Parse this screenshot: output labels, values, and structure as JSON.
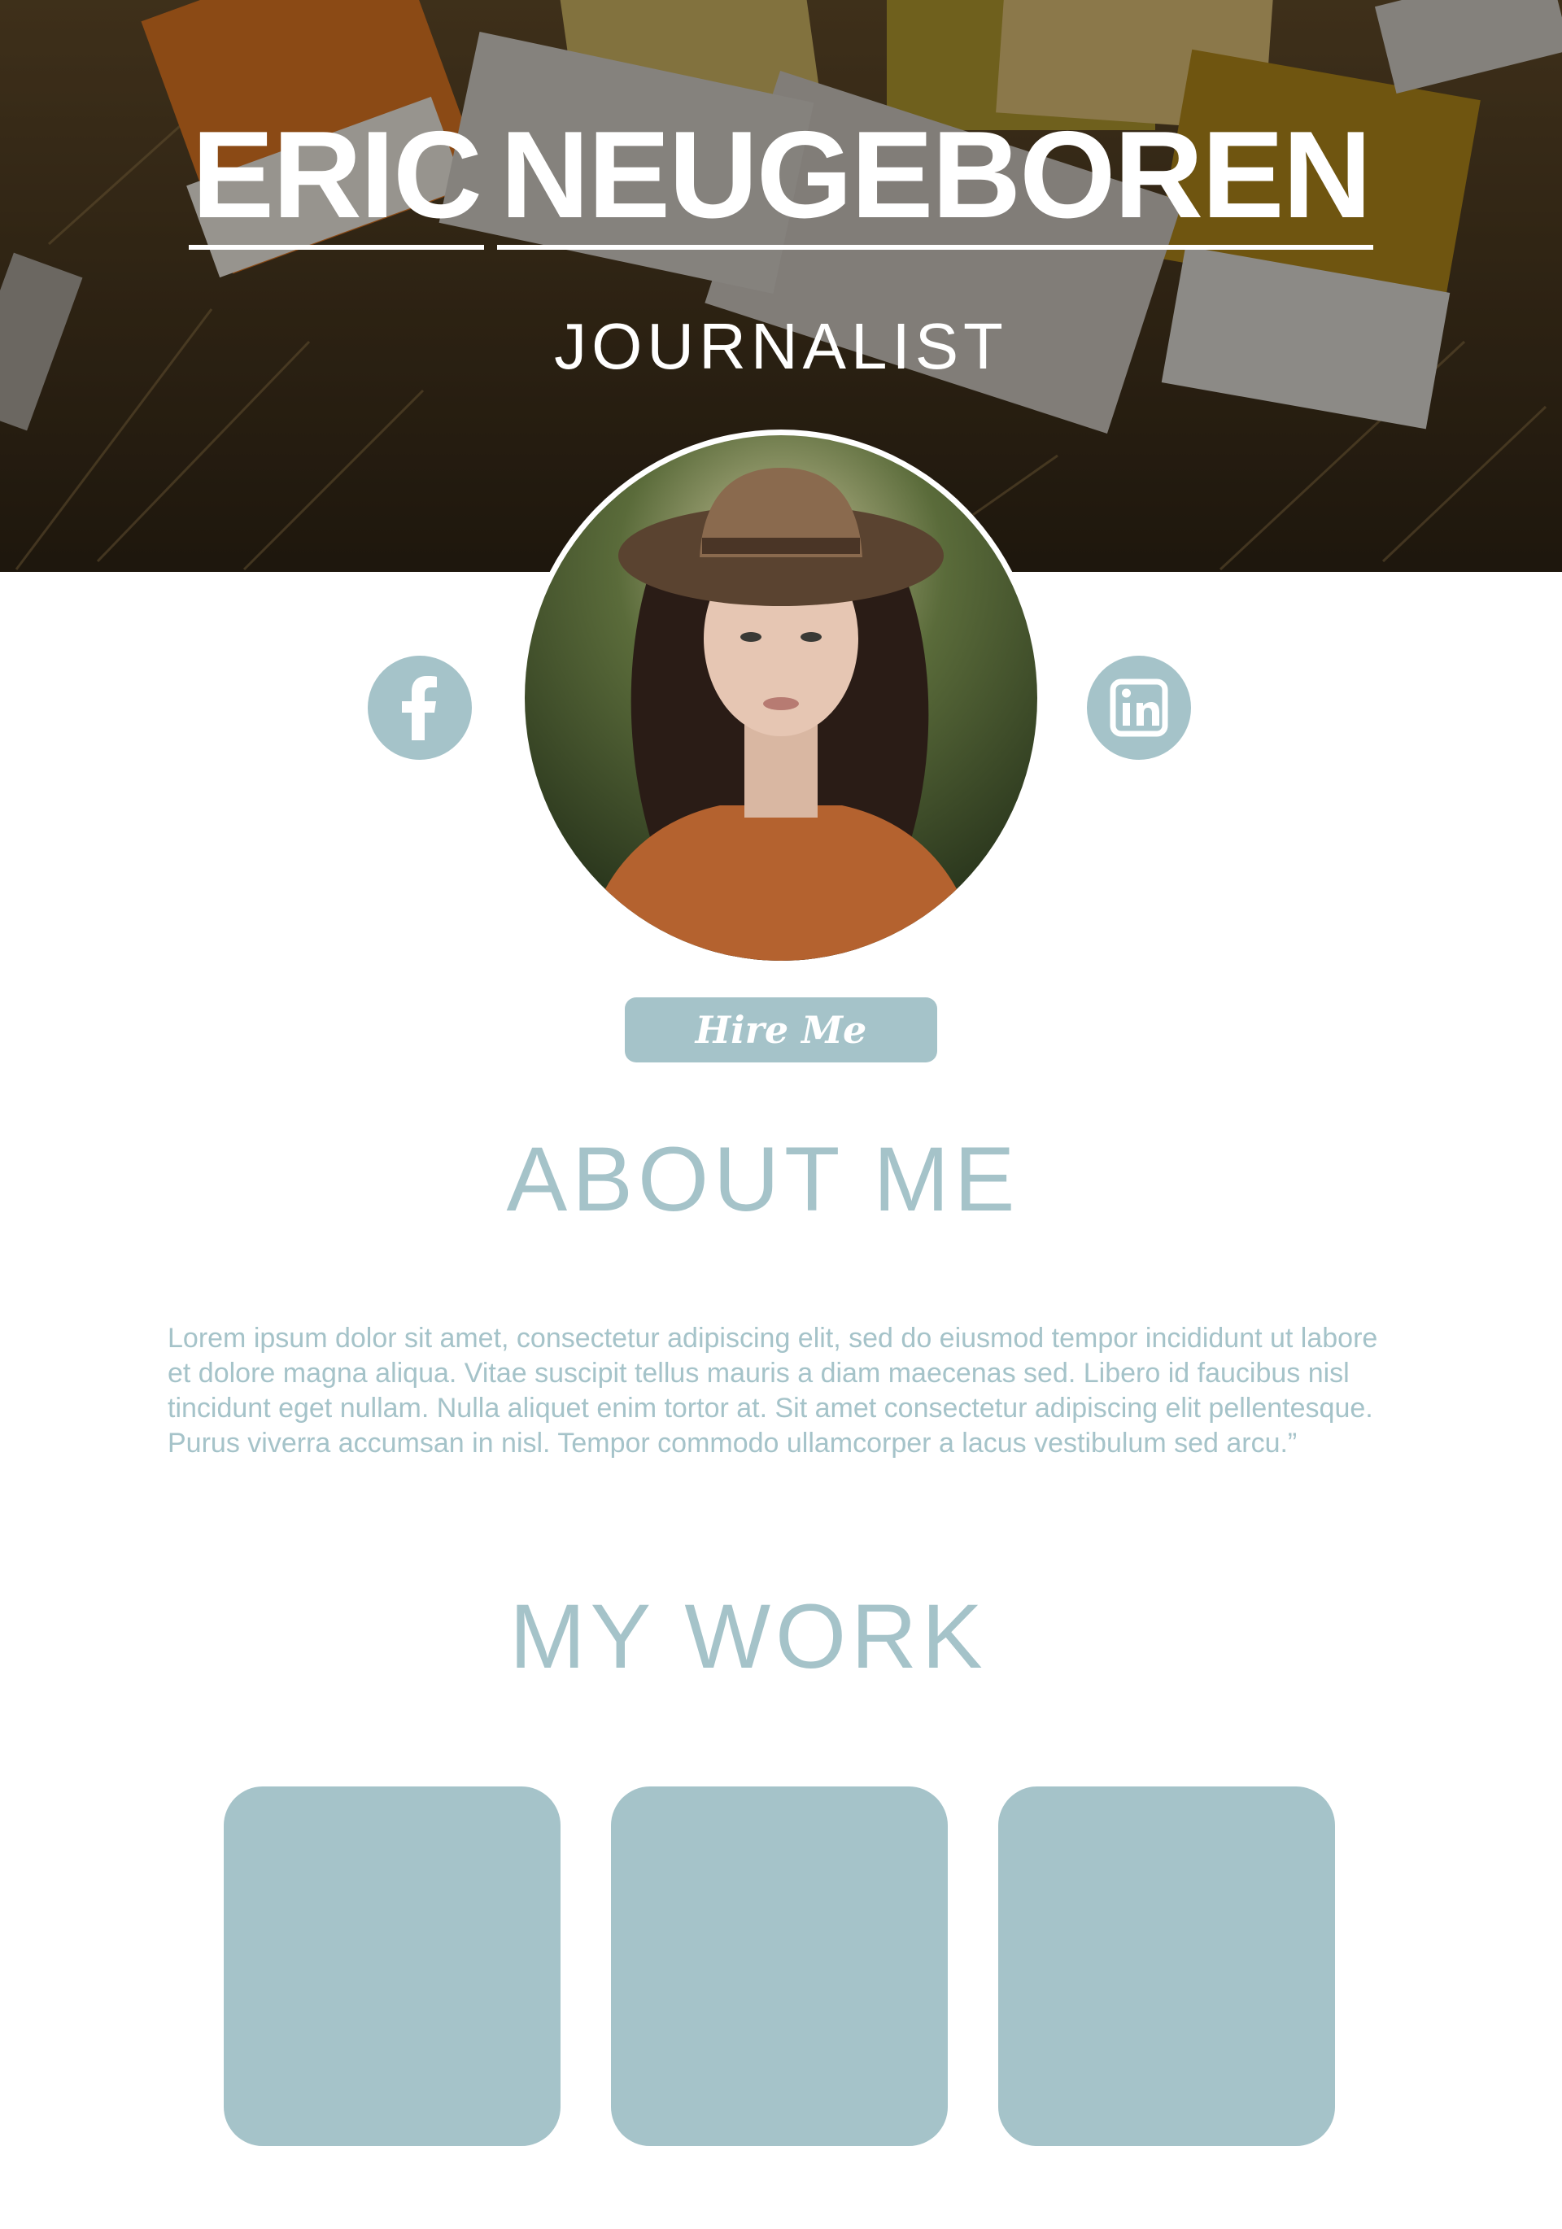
{
  "hero": {
    "name_first": "ERIC",
    "name_last": "NEUGEBOREN",
    "role": "JOURNALIST"
  },
  "profile": {
    "avatar_alt": "profile photo",
    "social": [
      {
        "icon": "facebook-icon",
        "glyph": "f"
      },
      {
        "icon": "linkedin-icon",
        "glyph": "in"
      }
    ],
    "hire_label": "Hire Me"
  },
  "about": {
    "title": "ABOUT ME",
    "body": "Lorem ipsum dolor sit amet, consectetur adipiscing elit, sed do eiusmod tempor incididunt ut labore et dolore magna aliqua. Vitae suscipit tellus mauris a diam maecenas sed. Libero id faucibus nisl tincidunt eget nullam. Nulla aliquet enim tortor at. Sit amet consectetur adipiscing elit pellentesque. Purus viverra accumsan in nisl. Tempor commodo ullamcorper a lacus vestibulum sed arcu.”"
  },
  "work": {
    "title": "MY WORK",
    "tiles": [
      "",
      "",
      ""
    ]
  },
  "colors": {
    "accent": "#a5c3c9",
    "hero_text": "#ffffff",
    "background": "#ffffff"
  }
}
